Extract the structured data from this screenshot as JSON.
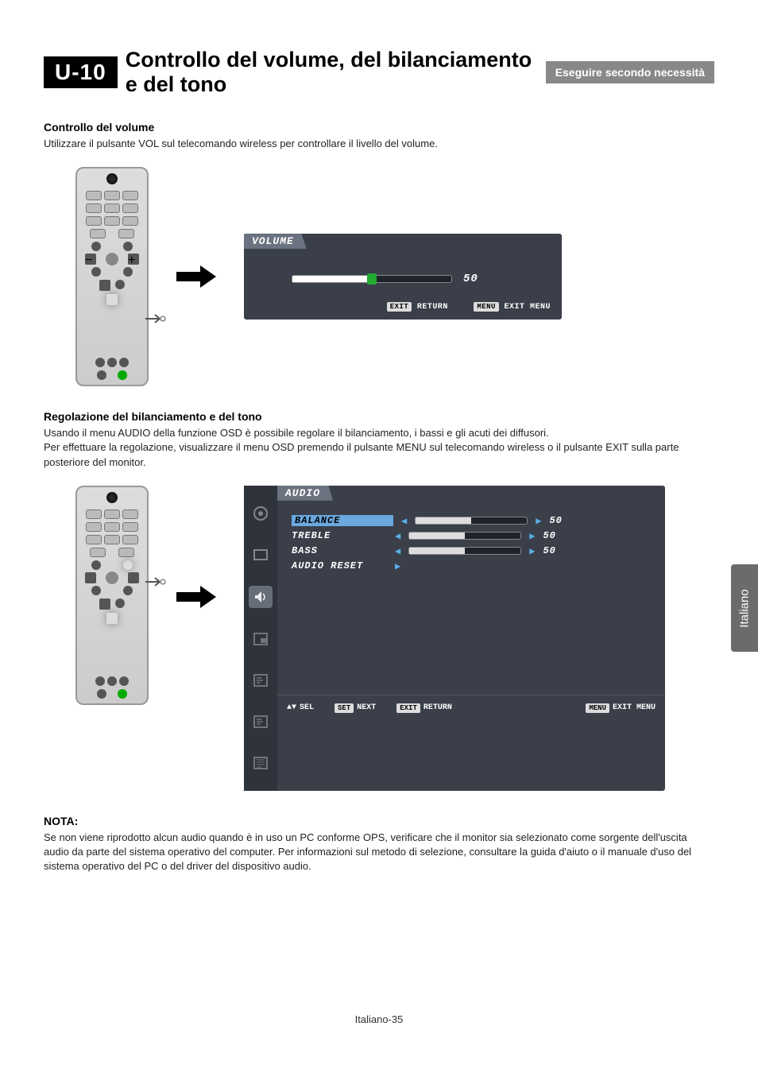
{
  "header": {
    "badge": "U-10",
    "title": "Controllo del volume, del bilanciamento e del tono",
    "necessity": "Eseguire secondo necessità"
  },
  "section1": {
    "heading": "Controllo del volume",
    "text": "Utilizzare il pulsante VOL sul telecomando wireless per controllare il livello del volume."
  },
  "osd_volume": {
    "title": "VOLUME",
    "value": "50",
    "footer": {
      "exit": "EXIT",
      "return": "RETURN",
      "menu": "MENU",
      "exitmenu": "EXIT MENU"
    }
  },
  "section2": {
    "heading": "Regolazione del bilanciamento e del tono",
    "line1": "Usando il menu AUDIO della funzione OSD è possibile regolare il bilanciamento, i bassi e gli acuti dei diffusori.",
    "line2": "Per effettuare la regolazione, visualizzare il menu OSD premendo il pulsante MENU sul telecomando wireless o il pulsante EXIT sulla parte posteriore del monitor."
  },
  "osd_audio": {
    "title": "AUDIO",
    "items": [
      {
        "label": "BALANCE",
        "value": "50",
        "highlight": true
      },
      {
        "label": "TREBLE",
        "value": "50",
        "highlight": false
      },
      {
        "label": "BASS",
        "value": "50",
        "highlight": false
      },
      {
        "label": "AUDIO RESET",
        "value": "",
        "highlight": false
      }
    ],
    "footer": {
      "sel_icon": "▲▼",
      "sel": "SEL",
      "set": "SET",
      "next": "NEXT",
      "exit": "EXIT",
      "return": "RETURN",
      "menu": "MENU",
      "exitmenu": "EXIT MENU"
    }
  },
  "note": {
    "heading": "NOTA:",
    "text": "Se non viene riprodotto alcun audio quando è in uso un PC conforme OPS, verificare che il monitor sia selezionato come sorgente dell'uscita audio da parte del sistema operativo del computer. Per informazioni sul metodo di selezione, consultare la guida d'aiuto o il manuale d'uso del sistema operativo del PC o del driver del dispositivo audio."
  },
  "side_tab": "Italiano",
  "page_number": "Italiano-35"
}
